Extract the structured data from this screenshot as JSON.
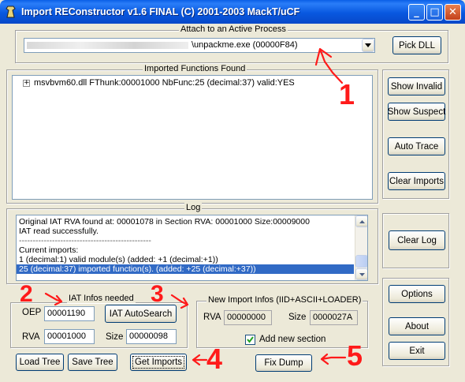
{
  "window": {
    "title": "Import REConstructor v1.6 FINAL (C) 2001-2003 MackT/uCF",
    "minimize": "_",
    "maximize": "□",
    "close": "✕"
  },
  "attach": {
    "legend": "Attach to an Active Process",
    "process_value": "\\unpackme.exe (00000F84)",
    "pick_dll": "Pick DLL"
  },
  "imports": {
    "legend": "Imported Functions Found",
    "expander": "+",
    "tree_item": "msvbvm60.dll FThunk:00001000 NbFunc:25 (decimal:37) valid:YES"
  },
  "side_buttons": {
    "show_invalid": "Show Invalid",
    "show_suspect": "Show Suspect",
    "auto_trace": "Auto Trace",
    "clear_imports": "Clear Imports",
    "clear_log": "Clear Log",
    "options": "Options",
    "about": "About",
    "exit": "Exit"
  },
  "log": {
    "legend": "Log",
    "lines": [
      "Original IAT RVA found at: 00001078 in Section RVA: 00001000 Size:00009000",
      "IAT read successfully.",
      "------------------------------------------------",
      "Current imports:",
      "1 (decimal:1) valid module(s) (added: +1 (decimal:+1))",
      "25 (decimal:37) imported function(s). (added: +25 (decimal:+37))"
    ]
  },
  "iat": {
    "legend": "IAT Infos needed",
    "oep_label": "OEP",
    "oep_value": "00001190",
    "autosearch": "IAT AutoSearch",
    "rva_label": "RVA",
    "rva_value": "00001000",
    "size_label": "Size",
    "size_value": "00000098"
  },
  "new_import": {
    "legend": "New Import Infos (IID+ASCII+LOADER)",
    "rva_label": "RVA",
    "rva_value": "00000000",
    "size_label": "Size",
    "size_value": "0000027A",
    "add_section_label": "Add new section"
  },
  "bottom_buttons": {
    "load_tree": "Load Tree",
    "save_tree": "Save Tree",
    "get_imports": "Get Imports",
    "fix_dump": "Fix Dump"
  },
  "annotations": {
    "n1": "1",
    "n2": "2",
    "n3": "3",
    "n4": "4",
    "n5": "5",
    "color": "#ff1a1a"
  },
  "colors": {
    "titlebar": "#0a5fe6",
    "selection": "#316ac5",
    "window_bg": "#ece9d8"
  }
}
